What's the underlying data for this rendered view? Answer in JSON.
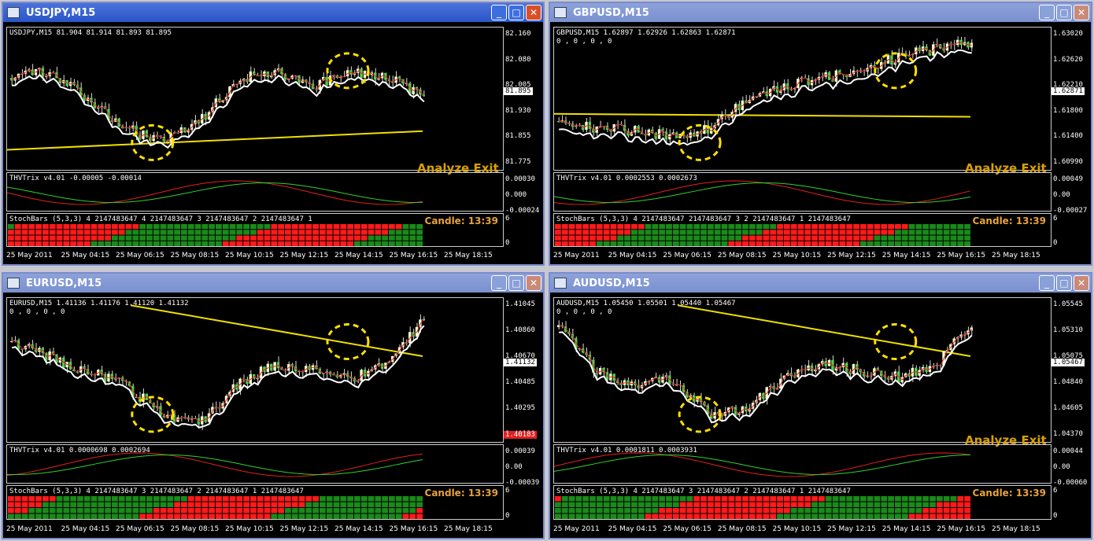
{
  "windows": [
    {
      "id": "usdjpy",
      "title": "USDJPY,M15",
      "active": true,
      "info": "USDJPY,M15  81.904 81.914 81.893 81.895",
      "sub_info": "",
      "price_ticks": [
        "82.160",
        "82.080",
        "82.005",
        "81.930",
        "81.855",
        "81.775"
      ],
      "current_price": "81.895",
      "trix_label": "THVTrix v4.01 -0.00005 -0.00014",
      "trix_ticks": [
        "0.00030",
        "0.000",
        "-0.00024"
      ],
      "stoch_label": "StochBars (5,3,3) 4 2147483647 4 2147483647 3 2147483647 2 2147483647 1",
      "stoch_ticks": [
        "6",
        "0"
      ],
      "candle_text": "Candle:  13:39",
      "ghost_text": "Analyze Exit",
      "time_labels": [
        "25 May 2011",
        "25 May 04:15",
        "25 May 06:15",
        "25 May 08:15",
        "25 May 10:15",
        "25 May 12:15",
        "25 May 14:15",
        "25 May 16:15",
        "25 May 18:15"
      ]
    },
    {
      "id": "gbpusd",
      "title": "GBPUSD,M15",
      "active": false,
      "info": "GBPUSD,M15  1.62897 1.62926 1.62863 1.62871",
      "sub_info": "0 , 0 , 0 , 0",
      "price_ticks": [
        "1.63020",
        "1.62620",
        "1.62210",
        "1.61800",
        "1.61400",
        "1.60990"
      ],
      "current_price": "1.62871",
      "trix_label": "THVTrix v4.01 0.0002553 0.0002673",
      "trix_ticks": [
        "0.00049",
        "0.00",
        "-0.00027"
      ],
      "stoch_label": "StochBars (5,3,3) 4 2147483647 2147483647 3 2 2147483647 1 2147483647",
      "stoch_ticks": [
        "6",
        "0"
      ],
      "candle_text": "Candle:  13:39",
      "ghost_text": "Analyze Exit",
      "time_labels": [
        "25 May 2011",
        "25 May 04:15",
        "25 May 06:15",
        "25 May 08:15",
        "25 May 10:15",
        "25 May 12:15",
        "25 May 14:15",
        "25 May 16:15",
        "25 May 18:15"
      ]
    },
    {
      "id": "eurusd",
      "title": "EURUSD,M15",
      "active": false,
      "info": "EURUSD,M15  1.41136 1.41176 1.41120 1.41132",
      "sub_info": "0 , 0 , 0 , 0",
      "price_ticks": [
        "1.41045",
        "1.40860",
        "1.40670",
        "1.40485",
        "1.40295",
        "1.40110"
      ],
      "current_price": "1.41132",
      "red_price": "1.40183",
      "trix_label": "THVTrix v4.01 0.0000698 0.0002694",
      "trix_ticks": [
        "0.00039",
        "0.00",
        "-0.00039"
      ],
      "stoch_label": "StochBars (5,3,3) 4 2147483647 3 2147483647 2 2147483647 1 2147483647",
      "stoch_ticks": [
        "6",
        "0"
      ],
      "candle_text": "Candle:  13:39",
      "ghost_text": "",
      "time_labels": [
        "25 May 2011",
        "25 May 04:15",
        "25 May 06:15",
        "25 May 08:15",
        "25 May 10:15",
        "25 May 12:15",
        "25 May 14:15",
        "25 May 16:15",
        "25 May 18:15"
      ]
    },
    {
      "id": "audusd",
      "title": "AUDUSD,M15",
      "active": false,
      "info": "AUDUSD,M15  1.05450 1.05501 1.05440 1.05467",
      "sub_info": "0 , 0 , 0 , 0",
      "price_ticks": [
        "1.05545",
        "1.05310",
        "1.05075",
        "1.04840",
        "1.04605",
        "1.04370"
      ],
      "current_price": "1.05467",
      "trix_label": "THVTrix v4.01 0.0001811 0.0003931",
      "trix_ticks": [
        "0.00044",
        "0.00",
        "-0.00060"
      ],
      "stoch_label": "StochBars (5,3,3) 4 2147483647 3 2147483647 2 2147483647 1 2147483647",
      "stoch_ticks": [
        "6",
        "0"
      ],
      "candle_text": "Candle:  13:39",
      "ghost_text": "Analyze Exit",
      "time_labels": [
        "25 May 2011",
        "25 May 04:15",
        "25 May 06:15",
        "25 May 08:15",
        "25 May 10:15",
        "25 May 12:15",
        "25 May 14:15",
        "25 May 16:15",
        "25 May 18:15"
      ]
    }
  ],
  "colors": {
    "bull_candle": "#f5ffd0",
    "bear_candle": "#4cd04c",
    "ma_white": "#ffffff",
    "ma_yellow": "#f0e000",
    "ma_red": "#e02020",
    "stoch_red": "#ff1a1a",
    "stoch_green": "#1a8a1a",
    "highlight_circle": "#ffe000",
    "arrow_pink": "#ffb0c0",
    "arrow_green": "#4cd04c",
    "arrow_red": "#ff2020"
  }
}
